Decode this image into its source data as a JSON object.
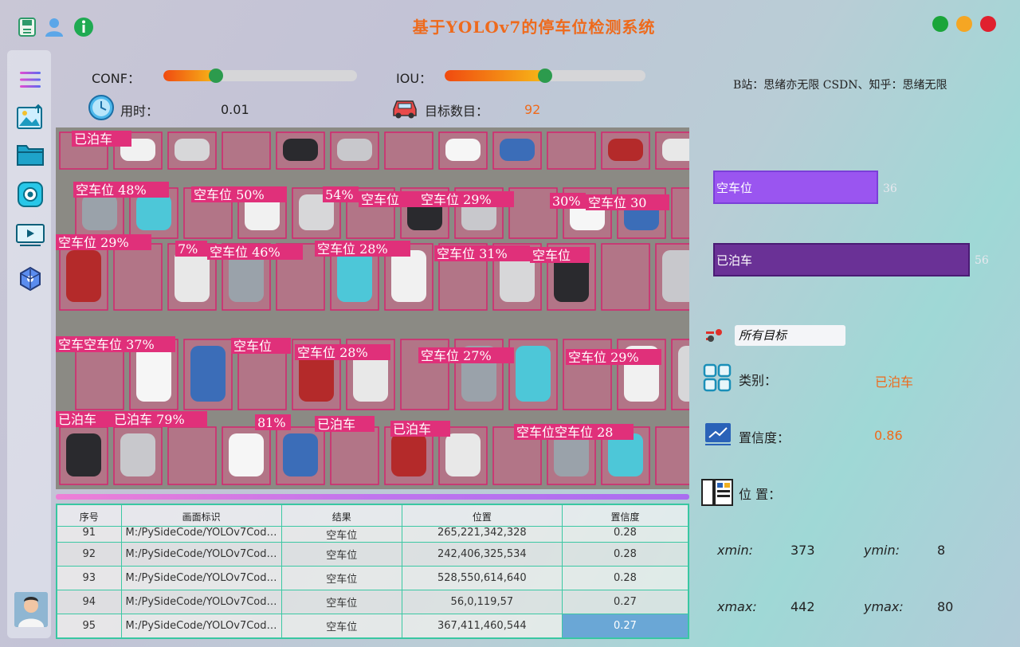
{
  "header": {
    "title": "基于YOLOv7的停车位检测系统",
    "icons": [
      "save-icon",
      "user-icon",
      "info-icon"
    ],
    "window_buttons": {
      "colors": [
        "#1aa53a",
        "#f5a623",
        "#e0202e"
      ]
    }
  },
  "sidebar": {
    "icons": [
      "menu-icon",
      "image-upload-icon",
      "folder-icon",
      "camera-icon",
      "video-icon",
      "model-icon"
    ]
  },
  "params": {
    "conf_label": "CONF：",
    "conf_value": 0.27,
    "iou_label": "IOU：",
    "iou_value": 0.5,
    "time_label": "用时：",
    "time_value": "0.01",
    "count_label": "目标数目：",
    "count_value": "92"
  },
  "credit": "B站：思绪亦无限  CSDN、知乎：思绪无限",
  "stats": {
    "bars": [
      {
        "label": "空车位",
        "value": 36,
        "color": "#9a55f0",
        "border": "#7a3fd8"
      },
      {
        "label": "已泊车",
        "value": 56,
        "color": "#6a3196",
        "border": "#4a1b74"
      }
    ]
  },
  "selector": {
    "value": "所有目标"
  },
  "detail": {
    "class_label": "类别：",
    "class_value": "已泊车",
    "conf_label": "置信度：",
    "conf_value": "0.86",
    "pos_label": "位  置：",
    "xmin_label": "xmin:",
    "xmin": "373",
    "ymin_label": "ymin:",
    "ymin": "8",
    "xmax_label": "xmax:",
    "xmax": "442",
    "ymax_label": "ymax:",
    "ymax": "80"
  },
  "table": {
    "headers": [
      "序号",
      "画面标识",
      "结果",
      "位置",
      "置信度"
    ],
    "rows": [
      [
        "91",
        "M:/PySideCode/YOLOv7Code/...",
        "空车位",
        "265,221,342,328",
        "0.28"
      ],
      [
        "92",
        "M:/PySideCode/YOLOv7Code/...",
        "空车位",
        "242,406,325,534",
        "0.28"
      ],
      [
        "93",
        "M:/PySideCode/YOLOv7Code/...",
        "空车位",
        "528,550,614,640",
        "0.28"
      ],
      [
        "94",
        "M:/PySideCode/YOLOv7Code/...",
        "空车位",
        "56,0,119,57",
        "0.27"
      ],
      [
        "95",
        "M:/PySideCode/YOLOv7Code/...",
        "空车位",
        "367,411,460,544",
        "0.27"
      ]
    ],
    "selected_row": 4
  },
  "detections": {
    "row_labels": [
      {
        "text": "已泊车",
        "pct": ""
      },
      {
        "text": "空车位",
        "pct": "48%"
      },
      {
        "text": "空车位",
        "pct": "50%"
      },
      {
        "text": "",
        "pct": "54%"
      },
      {
        "text": "空车位",
        "pct": ""
      },
      {
        "text": "空车位",
        "pct": "29%"
      },
      {
        "text": "",
        "pct": "30%"
      },
      {
        "text": "空车位",
        "pct": "30"
      },
      {
        "text": "空车位",
        "pct": "29%"
      },
      {
        "text": "",
        "pct": "7%"
      },
      {
        "text": "空车位",
        "pct": "46%"
      },
      {
        "text": "空车位",
        "pct": "28%"
      },
      {
        "text": "空车位",
        "pct": "31%"
      },
      {
        "text": "空车位",
        "pct": ""
      },
      {
        "text": "空车空车位",
        "pct": "37%"
      },
      {
        "text": "空车位",
        "pct": ""
      },
      {
        "text": "空车位",
        "pct": "28%"
      },
      {
        "text": "空车位",
        "pct": "27%"
      },
      {
        "text": "空车位",
        "pct": "29%"
      },
      {
        "text": "已泊车",
        "pct": ""
      },
      {
        "text": "已泊车",
        "pct": "79%"
      },
      {
        "text": "",
        "pct": "81%"
      },
      {
        "text": "已泊车",
        "pct": ""
      },
      {
        "text": "已泊车",
        "pct": ""
      },
      {
        "text": "空车位空车位",
        "pct": "28"
      }
    ]
  }
}
